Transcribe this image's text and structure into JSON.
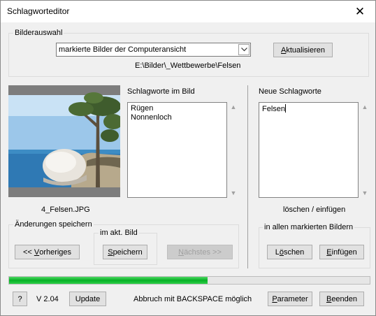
{
  "window": {
    "title": "Schlagworteditor",
    "close_glyph": "✕"
  },
  "bilderauswahl": {
    "label": "Bilderauswahl",
    "combo_value": "markierte Bilder der Computeransicht",
    "refresh_mnemonic": "A",
    "refresh_rest": "ktualisieren",
    "path": "E:\\Bilder\\_Wettbewerbe\\Felsen"
  },
  "image": {
    "filename": "4_Felsen.JPG"
  },
  "keywords_in_image": {
    "label": "Schlagworte im Bild",
    "items": [
      "Rügen",
      "Nonnenloch"
    ]
  },
  "new_keywords": {
    "label": "Neue Schlagworte",
    "text": "Felsen",
    "hint": "löschen / einfügen"
  },
  "save_changes": {
    "label": "Änderungen speichern",
    "prev_prefix": "<< ",
    "prev_mnemonic": "V",
    "prev_rest": "orheriges",
    "current_group_label": "im akt. Bild",
    "save_mnemonic": "S",
    "save_rest": "peichern",
    "next_mnemonic": "N",
    "next_rest": "ächstes >>"
  },
  "all_marked": {
    "label": "in allen markierten Bildern",
    "delete_pre": "L",
    "delete_mnemonic": "ö",
    "delete_rest": "schen",
    "insert_mnemonic": "E",
    "insert_rest": "infügen"
  },
  "progress": {
    "value": 0.55
  },
  "footer": {
    "help_label": "?",
    "version": "V 2.04",
    "update_label": "Update",
    "hint": "Abbruch mit BACKSPACE möglich",
    "params_mnemonic": "P",
    "params_rest": "arameter",
    "quit_mnemonic": "B",
    "quit_rest": "eenden"
  },
  "colors": {
    "progress": "#06b025",
    "window_bg": "#f0f0f0"
  }
}
